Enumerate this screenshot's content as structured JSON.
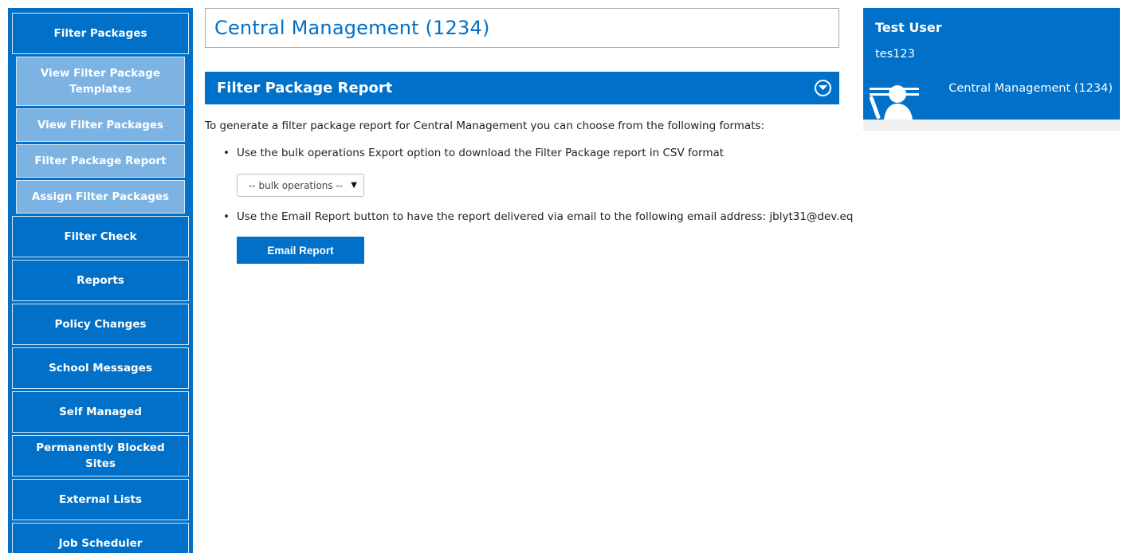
{
  "sidebar": {
    "items": [
      {
        "label": "Filter Packages",
        "type": "main"
      },
      {
        "label": "View Filter Package Templates",
        "type": "sub"
      },
      {
        "label": "View Filter Packages",
        "type": "sub"
      },
      {
        "label": "Filter Package Report",
        "type": "sub"
      },
      {
        "label": "Assign Filter Packages",
        "type": "sub"
      },
      {
        "label": "Filter Check",
        "type": "main"
      },
      {
        "label": "Reports",
        "type": "main"
      },
      {
        "label": "Policy Changes",
        "type": "main"
      },
      {
        "label": "School Messages",
        "type": "main"
      },
      {
        "label": "Self Managed",
        "type": "main"
      },
      {
        "label": "Permanently Blocked Sites",
        "type": "main"
      },
      {
        "label": "External Lists",
        "type": "main"
      },
      {
        "label": "Job Scheduler",
        "type": "main"
      }
    ]
  },
  "main": {
    "page_title": "Central Management (1234)",
    "section_title": "Filter Package Report",
    "intro": "To generate a filter package report for Central Management you can choose from the following formats:",
    "bullet1": "Use the bulk operations Export option to download the Filter Package report in CSV format",
    "bulk_select_value": "-- bulk operations --",
    "bullet2": "Use the Email Report button to have the report delivered via email to the following email address: jblyt31@dev.eq",
    "email_button_label": "Email Report"
  },
  "user": {
    "name": "Test User",
    "id": "tes123",
    "org": "Central Management (1234)"
  },
  "colors": {
    "primary": "#0070c8",
    "sub_item": "#7db3e3"
  }
}
